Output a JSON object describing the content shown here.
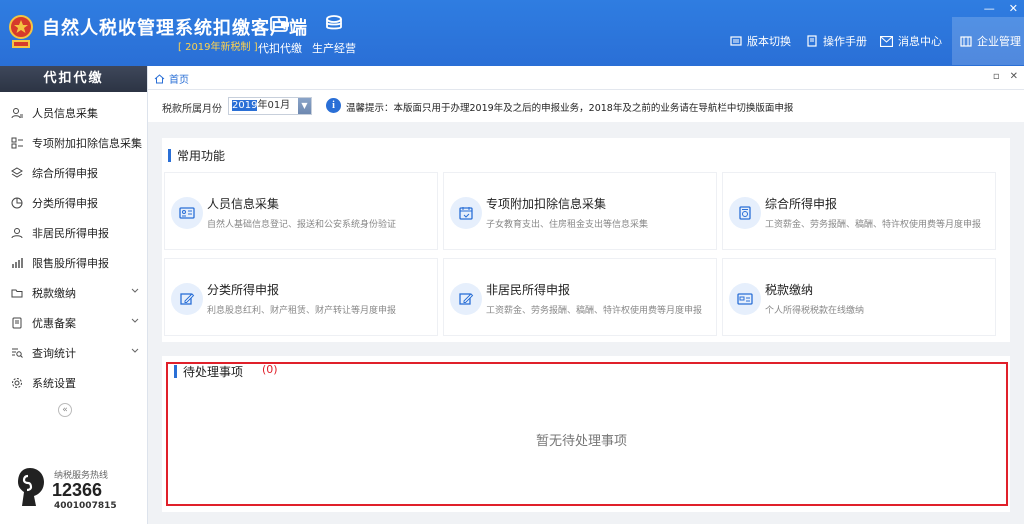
{
  "app": {
    "title": "自然人税收管理系统扣缴客户端",
    "version": "[ 2019年新税制 ]"
  },
  "topnav": [
    {
      "label": "代扣代缴",
      "icon": "wallet-icon"
    },
    {
      "label": "生产经营",
      "icon": "coins-icon"
    }
  ],
  "right_nav": [
    {
      "label": "版本切换",
      "icon": "switch-icon"
    },
    {
      "label": "操作手册",
      "icon": "manual-icon"
    },
    {
      "label": "消息中心",
      "icon": "mail-icon"
    },
    {
      "label": "企业管理",
      "icon": "enterprise-icon"
    }
  ],
  "window": {
    "minimize": "—",
    "close": "✕"
  },
  "sidebar": {
    "header": "代扣代缴",
    "items": [
      {
        "label": "人员信息采集",
        "icon": "person-id-icon",
        "expandable": false
      },
      {
        "label": "专项附加扣除信息采集",
        "icon": "grid-icon",
        "expandable": true
      },
      {
        "label": "综合所得申报",
        "icon": "layers-icon",
        "expandable": false
      },
      {
        "label": "分类所得申报",
        "icon": "pie-chart-icon",
        "expandable": false
      },
      {
        "label": "非居民所得申报",
        "icon": "user-icon",
        "expandable": false
      },
      {
        "label": "限售股所得申报",
        "icon": "bar-chart-icon",
        "expandable": false
      },
      {
        "label": "税款缴纳",
        "icon": "folder-icon",
        "expandable": true
      },
      {
        "label": "优惠备案",
        "icon": "document-icon",
        "expandable": true
      },
      {
        "label": "查询统计",
        "icon": "search-list-icon",
        "expandable": true
      },
      {
        "label": "系统设置",
        "icon": "gear-icon",
        "expandable": false
      }
    ],
    "collapse": "«",
    "hotline": {
      "label": "纳税服务热线",
      "number": "12366",
      "number2": "4001007815"
    }
  },
  "tabbar": {
    "home": "首页",
    "restore": "▫",
    "close": "✕"
  },
  "filter": {
    "label": "税款所属月份",
    "value_year": "2019",
    "value_rest": "年01月",
    "notice": "温馨提示：本版面只用于办理2019年及之后的申报业务，2018年及之前的业务请在导航栏中切换版面申报"
  },
  "common": {
    "title": "常用功能",
    "cards": [
      {
        "title": "人员信息采集",
        "desc": "自然人基础信息登记、报送和公安系统身份验证",
        "icon": "id-card-icon"
      },
      {
        "title": "专项附加扣除信息采集",
        "desc": "子女教育支出、住房租金支出等信息采集",
        "icon": "calendar-icon"
      },
      {
        "title": "综合所得申报",
        "desc": "工资薪金、劳务报酬、稿酬、特许权使用费等月度申报",
        "icon": "report-icon"
      },
      {
        "title": "分类所得申报",
        "desc": "利息股息红利、财产租赁、财产转让等月度申报",
        "icon": "edit-icon"
      },
      {
        "title": "非居民所得申报",
        "desc": "工资薪金、劳务报酬、稿酬、特许权使用费等月度申报",
        "icon": "edit-icon"
      },
      {
        "title": "税款缴纳",
        "desc": "个人所得税税款在线缴纳",
        "icon": "payment-icon"
      }
    ]
  },
  "pending": {
    "title": "待处理事项",
    "count": "(0)",
    "empty": "暂无待处理事项"
  }
}
